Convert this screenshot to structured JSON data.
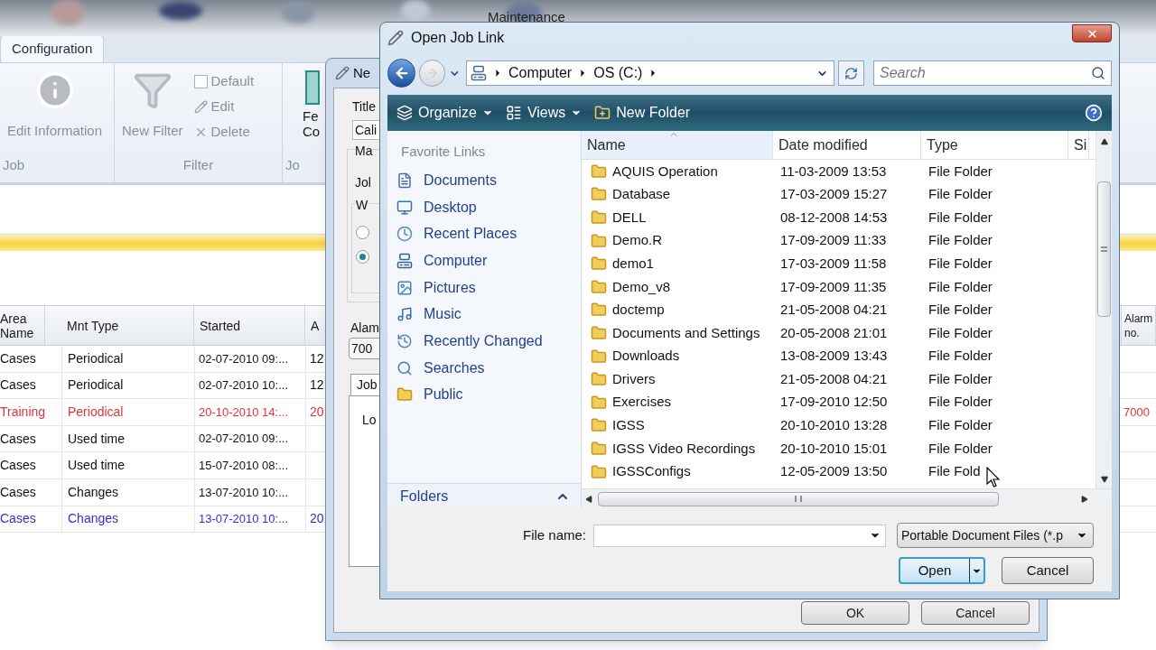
{
  "maintenance": {
    "title": "Maintenance",
    "tabs": [
      {
        "label": "Configuration",
        "selected": true
      }
    ],
    "ribbon_groups": [
      {
        "label": "Job",
        "items": [
          {
            "kind": "info-large",
            "label": "Edit Information",
            "disabled": true
          }
        ]
      },
      {
        "label": "Filter",
        "items": [
          {
            "kind": "filter-large",
            "label": "New Filter",
            "disabled": true
          },
          {
            "kind": "checkbox",
            "label": "Default",
            "checked": false,
            "disabled": true
          },
          {
            "kind": "edit-small",
            "label": "Edit",
            "disabled": true
          },
          {
            "kind": "delete-small",
            "label": "Delete",
            "disabled": true
          }
        ]
      },
      {
        "label": "Jo",
        "items": [
          {
            "kind": "cut-large",
            "lines": [
              "Fe",
              "Co"
            ],
            "disabled": false
          }
        ]
      }
    ],
    "table": {
      "columns": [
        "Area Name",
        "Mnt Type",
        "Started",
        "A",
        "Alarm no."
      ],
      "rows": [
        {
          "area": "Cases",
          "type": "Periodical",
          "started": "02-07-2010 09:...",
          "column_4": "12",
          "color": "#111111"
        },
        {
          "area": "Cases",
          "type": "Periodical",
          "started": "02-07-2010 10:...",
          "column_4": "12",
          "color": "#111111"
        },
        {
          "area": "Training",
          "type": "Periodical",
          "started": "20-10-2010 14:...",
          "column_4": "20",
          "alarm_no": "7000",
          "color": "#e3323c"
        },
        {
          "area": "Cases",
          "type": "Used time",
          "started": "02-07-2010 09:...",
          "color": "#111111"
        },
        {
          "area": "Cases",
          "type": "Used time",
          "started": "15-07-2010 08:...",
          "color": "#111111"
        },
        {
          "area": "Cases",
          "type": "Changes",
          "started": "13-07-2010 10:...",
          "color": "#111111"
        },
        {
          "area": "Cases",
          "type": "Changes",
          "started": "13-07-2010 10:...",
          "column_4": "20",
          "color": "#3030d0"
        }
      ]
    }
  },
  "new_dialog": {
    "title": "Ne",
    "title_label": "Title",
    "title_value": "Cali",
    "group_label": "Ma",
    "job_label": "Jol",
    "subgroup_label": "W",
    "radios": [
      {
        "selected": false
      },
      {
        "selected": true
      }
    ],
    "alarm_label": "Alam",
    "alarm_value": "700",
    "tabs": [
      {
        "label": "Job",
        "selected": true
      }
    ],
    "panel_label": "Lo",
    "buttons": [
      "OK",
      "Cancel"
    ]
  },
  "open_dialog": {
    "title": "Open Job Link",
    "breadcrumb": [
      "Computer",
      "OS (C:)"
    ],
    "search": {
      "placeholder": "Search"
    },
    "toolbar": [
      {
        "kind": "organize",
        "label": "Organize"
      },
      {
        "kind": "views",
        "label": "Views"
      },
      {
        "kind": "new-folder",
        "label": "New Folder"
      }
    ],
    "favorite_links": {
      "heading": "Favorite Links",
      "items": [
        {
          "kind": "documents",
          "label": "Documents"
        },
        {
          "kind": "desktop",
          "label": "Desktop"
        },
        {
          "kind": "recent",
          "label": "Recent Places"
        },
        {
          "kind": "computer",
          "label": "Computer"
        },
        {
          "kind": "pictures",
          "label": "Pictures"
        },
        {
          "kind": "music",
          "label": "Music"
        },
        {
          "kind": "changed",
          "label": "Recently Changed"
        },
        {
          "kind": "searches",
          "label": "Searches"
        },
        {
          "kind": "public",
          "label": "Public"
        }
      ]
    },
    "folders": {
      "label": "Folders",
      "expanded": false
    },
    "files": {
      "columns": [
        {
          "label": "Name",
          "sorted": true
        },
        {
          "label": "Date modified",
          "sorted": false
        },
        {
          "label": "Type",
          "sorted": false
        },
        {
          "label": "Si",
          "sorted": false
        }
      ],
      "rows": [
        {
          "name": "AQUIS Operation",
          "date": "11-03-2009 13:53",
          "type": "File Folder"
        },
        {
          "name": "Database",
          "date": "17-03-2009 15:27",
          "type": "File Folder"
        },
        {
          "name": "DELL",
          "date": "08-12-2008 14:53",
          "type": "File Folder"
        },
        {
          "name": "Demo.R",
          "date": "17-09-2009 11:33",
          "type": "File Folder"
        },
        {
          "name": "demo1",
          "date": "17-03-2009 11:58",
          "type": "File Folder"
        },
        {
          "name": "Demo_v8",
          "date": "17-09-2009 11:35",
          "type": "File Folder"
        },
        {
          "name": "doctemp",
          "date": "21-05-2008 04:21",
          "type": "File Folder"
        },
        {
          "name": "Documents and Settings",
          "date": "20-05-2008 21:01",
          "type": "File Folder"
        },
        {
          "name": "Downloads",
          "date": "13-08-2009 13:43",
          "type": "File Folder"
        },
        {
          "name": "Drivers",
          "date": "21-05-2008 04:21",
          "type": "File Folder"
        },
        {
          "name": "Exercises",
          "date": "17-09-2010 12:50",
          "type": "File Folder"
        },
        {
          "name": "IGSS",
          "date": "20-10-2010 13:28",
          "type": "File Folder"
        },
        {
          "name": "IGSS Video Recordings",
          "date": "20-10-2010 15:01",
          "type": "File Folder"
        },
        {
          "name": "IGSSConfigs",
          "date": "12-05-2009 13:50",
          "type": "File Fold"
        }
      ]
    },
    "file_name": {
      "label": "File name:"
    },
    "file_type": "Portable Document Files (*.p",
    "buttons": [
      {
        "kind": "split",
        "label": "Open",
        "default": true
      },
      {
        "kind": "plain",
        "label": "Cancel",
        "default": false
      }
    ]
  }
}
